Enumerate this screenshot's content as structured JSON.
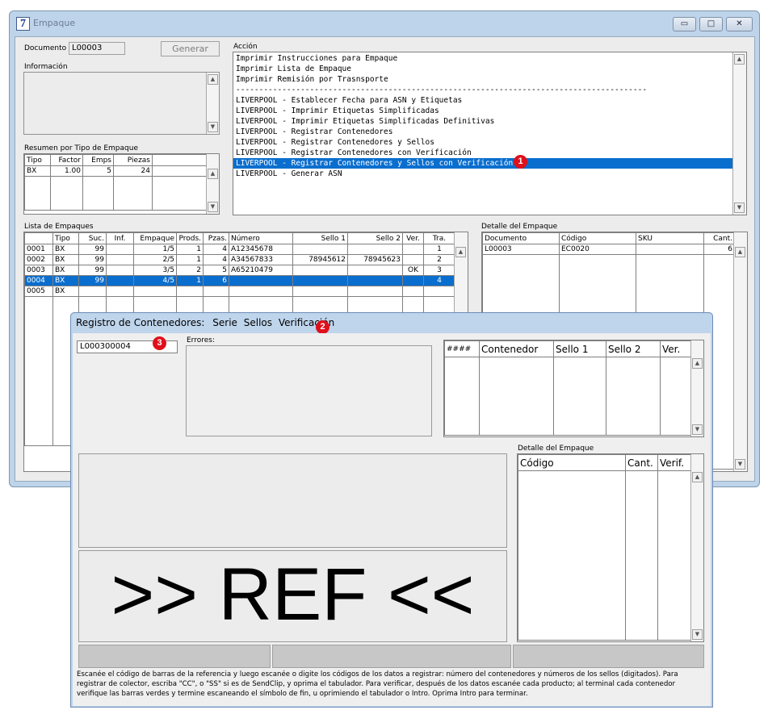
{
  "window": {
    "app_icon": "7",
    "title": "Empaque",
    "buttons": {
      "minimize": "▭",
      "maximize": "□",
      "close": "✕"
    }
  },
  "documento": {
    "label": "Documento :",
    "value": "L00003"
  },
  "generar_label": "Generar",
  "informacion_label": "Información",
  "resumen": {
    "label": "Resumen por Tipo de Empaque",
    "columns": [
      "Tipo",
      "Factor",
      "Emps",
      "Piezas"
    ],
    "rows": [
      {
        "tipo": "BX",
        "factor": "1.00",
        "emps": "5",
        "piezas": "24"
      }
    ]
  },
  "accion": {
    "label": "Acción",
    "items": [
      "Imprimir Instrucciones para Empaque",
      "Imprimir Lista de Empaque",
      "Imprimir Remisión por Trasnsporte",
      "-----------------------------------------------------------------------------------------",
      "LIVERPOOL - Establecer Fecha para ASN y Etiquetas",
      "LIVERPOOL - Imprimir Etiquetas Simplificadas",
      "LIVERPOOL - Imprimir Etiquetas Simplificadas Definitivas",
      "LIVERPOOL - Registrar Contenedores",
      "LIVERPOOL - Registrar Contenedores y Sellos",
      "LIVERPOOL - Registrar Contenedores con Verificación",
      "LIVERPOOL - Registrar Contenedores y Sellos con Verificación",
      "LIVERPOOL - Generar ASN"
    ],
    "selected_index": 10
  },
  "lista": {
    "label": "Lista de Empaques",
    "columns": [
      "",
      "Tipo",
      "Suc.",
      "Inf.",
      "Empaque",
      "Prods.",
      "Pzas.",
      "Número",
      "Sello 1",
      "Sello 2",
      "Ver.",
      "Tra."
    ],
    "rows": [
      [
        "0001",
        "BX",
        "99",
        "",
        "1/5",
        "1",
        "4",
        "A12345678",
        "",
        "",
        "",
        "1"
      ],
      [
        "0002",
        "BX",
        "99",
        "",
        "2/5",
        "1",
        "4",
        "A34567833",
        "78945612",
        "78945623",
        "",
        "2"
      ],
      [
        "0003",
        "BX",
        "99",
        "",
        "3/5",
        "2",
        "5",
        "A65210479",
        "",
        "",
        "OK",
        "3"
      ],
      [
        "0004",
        "BX",
        "99",
        "",
        "4/5",
        "1",
        "6",
        "",
        "",
        "",
        "",
        "4"
      ],
      [
        "0005",
        "BX",
        "",
        "",
        "",
        "",
        "",
        "",
        "",
        "",
        "",
        ""
      ]
    ],
    "selected_index": 3
  },
  "detalle": {
    "label": "Detalle del Empaque",
    "columns": [
      "Documento",
      "Código",
      "SKU",
      "Cant."
    ],
    "rows": [
      [
        "L00003",
        "EC0020",
        "",
        "6"
      ]
    ]
  },
  "dialog": {
    "menu": [
      "Registro de Contenedores:",
      "Serie",
      "Sellos",
      "Verificación"
    ],
    "input_value": "L000300004",
    "errores_label": "Errores:",
    "cont_columns": [
      "####",
      "Contenedor",
      "Sello 1",
      "Sello 2",
      "Ver."
    ],
    "detalle_label": "Detalle del Empaque",
    "detalle_columns": [
      "Código",
      "Cant.",
      "Verif."
    ],
    "big_text": ">> REF <<",
    "instructions": "Escanée el código de barras de la referencia y luego escanée o digite los códigos de los datos a registrar: número del contenedores y números de los sellos (digitados). Para registrar de colector, escriba \"CC\", o \"SS\" si es de SendClip, y oprima el tabulador. Para verificar, después de los datos escanée cada producto; al terminal cada contenedor verifique las barras verdes y termine escaneando el símbolo de fin, u oprimiendo el tabulador o Intro. Oprima Intro para terminar."
  },
  "markers": [
    "1",
    "2",
    "3"
  ]
}
